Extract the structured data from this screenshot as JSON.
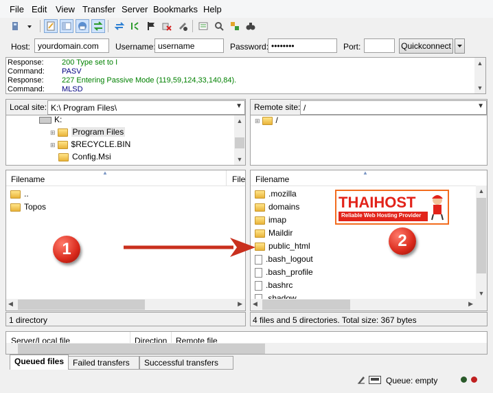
{
  "menu": [
    "File",
    "Edit",
    "View",
    "Transfer",
    "Server",
    "Bookmarks",
    "Help"
  ],
  "quickconnect": {
    "host_label": "Host:",
    "host_value": "yourdomain.com",
    "user_label": "Username:",
    "user_value": "username",
    "pass_label": "Password:",
    "pass_value": "••••••••",
    "port_label": "Port:",
    "port_value": "",
    "button": "Quickconnect"
  },
  "log": [
    {
      "k": "Response:",
      "v": "200 Type set to I",
      "color": "#008000"
    },
    {
      "k": "Command:",
      "v": "PASV",
      "color": "#000080"
    },
    {
      "k": "Response:",
      "v": "227 Entering Passive Mode (119,59,124,33,140,84).",
      "color": "#008000"
    },
    {
      "k": "Command:",
      "v": "MLSD",
      "color": "#000080"
    }
  ],
  "local": {
    "label": "Local site:",
    "path": "K:\\ Program Files\\",
    "tree": [
      "K:",
      "Program Files",
      "$RECYCLE.BIN",
      "Config.Msi"
    ],
    "col_filename": "Filename",
    "col_filesize": "File",
    "files": [
      "..",
      "Topos"
    ],
    "status": "1 directory"
  },
  "remote": {
    "label": "Remote site:",
    "path": "/",
    "tree": [
      "/"
    ],
    "col_filename": "Filename",
    "files": [
      {
        "name": ".mozilla",
        "type": "folder"
      },
      {
        "name": "domains",
        "type": "folder"
      },
      {
        "name": "imap",
        "type": "folder"
      },
      {
        "name": "Maildir",
        "type": "folder"
      },
      {
        "name": "public_html",
        "type": "folder"
      },
      {
        "name": ".bash_logout",
        "type": "file"
      },
      {
        "name": ".bash_profile",
        "type": "file"
      },
      {
        "name": ".bashrc",
        "type": "file"
      },
      {
        "name": ".shadow",
        "type": "file"
      }
    ],
    "status": "4 files and 5 directories. Total size: 367 bytes"
  },
  "queue": {
    "col_server": "Server/Local file",
    "col_direction": "Direction",
    "col_remote": "Remote file"
  },
  "tabs": [
    "Queued files",
    "Failed transfers",
    "Successful transfers"
  ],
  "statusbar": {
    "queue": "Queue: empty"
  },
  "annotations": {
    "badge1": "1",
    "badge2": "2"
  },
  "logo": {
    "title": "THAIHOST",
    "tagline": "Reliable Web Hosting Provider"
  },
  "colors": {
    "badge": "#d9291b",
    "arrow": "#c9301e",
    "logo_border": "#f26b1d",
    "logo_text": "#e2231a"
  }
}
